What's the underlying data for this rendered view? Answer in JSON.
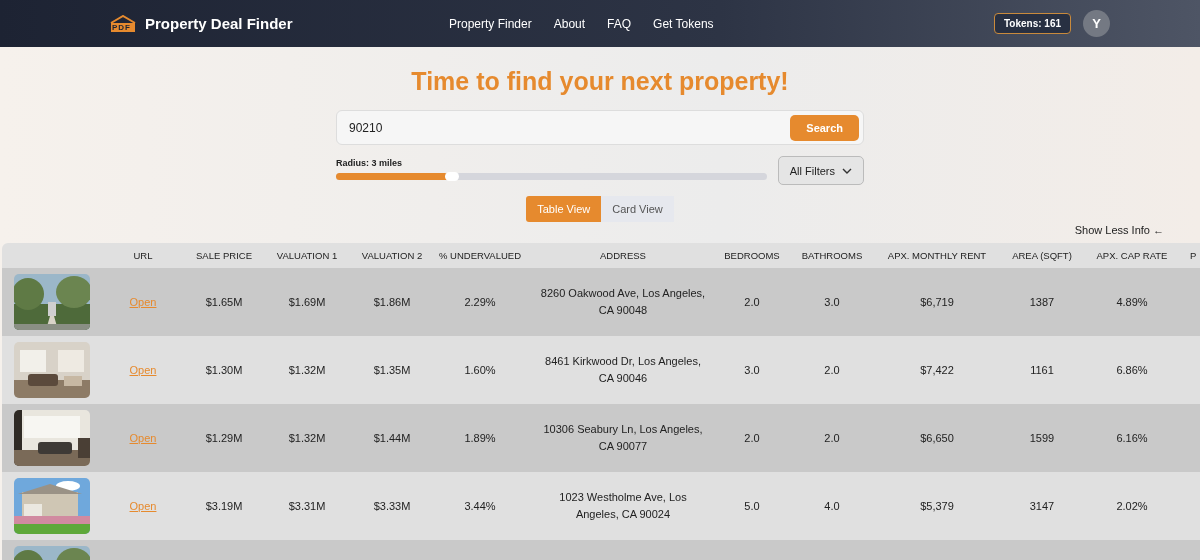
{
  "header": {
    "logo": {
      "mark": "PDF",
      "name": "Property Deal Finder"
    },
    "nav": [
      {
        "label": "Property Finder"
      },
      {
        "label": "About"
      },
      {
        "label": "FAQ"
      },
      {
        "label": "Get Tokens"
      }
    ],
    "tokens": "Tokens: 161",
    "avatar": "Y"
  },
  "title": "Time to find your next property!",
  "search": {
    "value": "90210",
    "button": "Search"
  },
  "radius": {
    "label": "Radius: 3 miles",
    "level": 0.27
  },
  "filters": {
    "label": "All Filters"
  },
  "views": [
    {
      "label": "Table View",
      "selected": true
    },
    {
      "label": "Card View",
      "selected": false
    }
  ],
  "info_toggle": "Show Less Info ←",
  "table": {
    "columns": [
      "URL",
      "SALE PRICE",
      "VALUATION 1",
      "VALUATION 2",
      "% UNDERVALUED",
      "ADDRESS",
      "BEDROOMS",
      "BATHROOMS",
      "APX. MONTHLY RENT",
      "AREA (SQFT)",
      "APX. CAP RATE",
      "P"
    ],
    "rows": [
      {
        "photo": {
          "kind": "picture"
        },
        "cells": [
          "Open",
          "$1.65M",
          "$1.69M",
          "$1.86M",
          "2.29%",
          "8260 Oakwood Ave, Los Angeles, CA 90048",
          "2.0",
          "3.0",
          "$6,719",
          "1387",
          "4.89%"
        ]
      },
      {
        "photo": {
          "kind": "picture"
        },
        "cells": [
          "Open",
          "$1.30M",
          "$1.32M",
          "$1.35M",
          "1.60%",
          "8461 Kirkwood Dr, Los Angeles, CA 90046",
          "3.0",
          "2.0",
          "$7,422",
          "1161",
          "6.86%"
        ]
      },
      {
        "photo": {
          "kind": "picture"
        },
        "cells": [
          "Open",
          "$1.29M",
          "$1.32M",
          "$1.44M",
          "1.89%",
          "10306 Seabury Ln, Los Angeles, CA 90077",
          "2.0",
          "2.0",
          "$6,650",
          "1599",
          "6.16%"
        ]
      },
      {
        "photo": {
          "kind": "picture"
        },
        "cells": [
          "Open",
          "$3.19M",
          "$3.31M",
          "$3.33M",
          "3.44%",
          "1023 Westholme Ave, Los Angeles, CA 90024",
          "5.0",
          "4.0",
          "$5,379",
          "3147",
          "2.02%"
        ]
      },
      {
        "photo": {
          "kind": "picture"
        },
        "cells": []
      }
    ]
  }
}
